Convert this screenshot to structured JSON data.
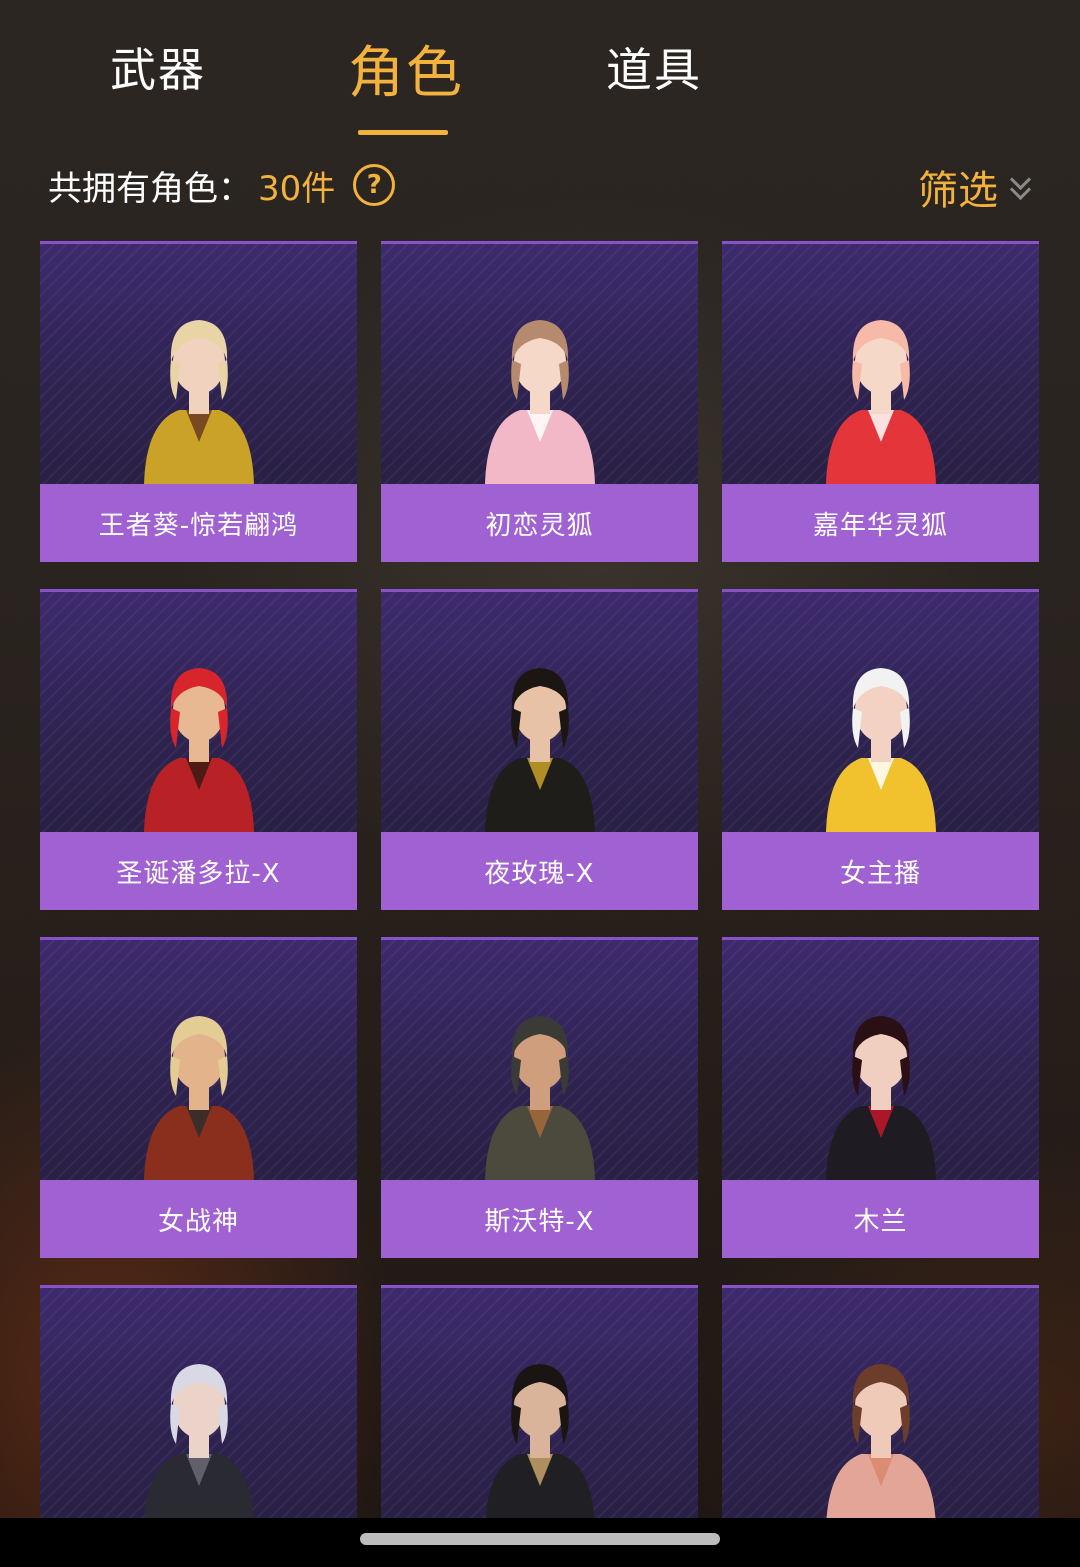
{
  "tabs": [
    {
      "label": "武器",
      "active": false
    },
    {
      "label": "角色",
      "active": true
    },
    {
      "label": "道具",
      "active": false
    }
  ],
  "summary": {
    "prefix": "共拥有角色：",
    "count": "30件",
    "help_icon": "question-circle-icon"
  },
  "filter": {
    "label": "筛选",
    "icon": "double-chevron-down-icon"
  },
  "colors": {
    "accent": "#f3b13d",
    "label_bg": "#a061d2",
    "card_bg": "#2e2350"
  },
  "characters": [
    {
      "name": "王者葵-惊若翩鸿",
      "look": {
        "hair": "#e8d4a4",
        "skin": "#f1d2bf",
        "outfit": "#c9a227",
        "accent": "#6b3a1f"
      }
    },
    {
      "name": "初恋灵狐",
      "look": {
        "hair": "#b58a6e",
        "skin": "#f6d8c8",
        "outfit": "#f3b8c8",
        "accent": "#ffffff"
      }
    },
    {
      "name": "嘉年华灵狐",
      "look": {
        "hair": "#f7b9a8",
        "skin": "#f6d8c8",
        "outfit": "#e3353a",
        "accent": "#ffffff"
      }
    },
    {
      "name": "圣诞潘多拉-X",
      "look": {
        "hair": "#d8252b",
        "skin": "#e7b892",
        "outfit": "#b82227",
        "accent": "#3a1a12"
      }
    },
    {
      "name": "夜玫瑰-X",
      "look": {
        "hair": "#1c1612",
        "skin": "#e7c2a6",
        "outfit": "#1f1d1a",
        "accent": "#c9a227"
      }
    },
    {
      "name": "女主播",
      "look": {
        "hair": "#f2f2f2",
        "skin": "#f3d2c4",
        "outfit": "#f2c12e",
        "accent": "#ffffff"
      }
    },
    {
      "name": "女战神",
      "look": {
        "hair": "#e4cc95",
        "skin": "#e3b48c",
        "outfit": "#8a2f1e",
        "accent": "#2d2d2d"
      }
    },
    {
      "name": "斯沃特-X",
      "look": {
        "hair": "#3a3a36",
        "skin": "#cf9e7c",
        "outfit": "#4b4a3c",
        "accent": "#a46a3a"
      }
    },
    {
      "name": "木兰",
      "look": {
        "hair": "#2a0f14",
        "skin": "#f1cfc0",
        "outfit": "#1f1b22",
        "accent": "#c4162a"
      }
    },
    {
      "name": "",
      "look": {
        "hair": "#d9d9e6",
        "skin": "#ecd3c9",
        "outfit": "#2a2a33",
        "accent": "#6a6a74"
      }
    },
    {
      "name": "",
      "look": {
        "hair": "#1a1512",
        "skin": "#d9b49a",
        "outfit": "#202024",
        "accent": "#caa36a"
      }
    },
    {
      "name": "",
      "look": {
        "hair": "#6b3d2a",
        "skin": "#efcab8",
        "outfit": "#e3a597",
        "accent": "#d9876c"
      }
    }
  ]
}
